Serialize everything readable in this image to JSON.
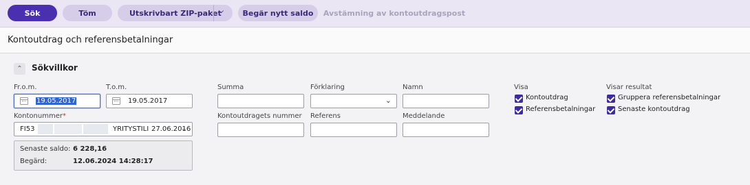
{
  "toolbar": {
    "search": "Sök",
    "clear": "Töm",
    "zip": "Utskrivbart ZIP-paket",
    "request_balance": "Begär nytt saldo",
    "reconcile": "Avstämning av kontoutdragspost"
  },
  "page_title": "Kontoutdrag och referensbetalningar",
  "section": {
    "title": "Sökvillkor"
  },
  "form": {
    "from_label": "Fr.o.m.",
    "from_value": "19.05.2017",
    "to_label": "T.o.m.",
    "to_value": "19.05.2017",
    "account_label": "Kontonummer",
    "required_mark": "*",
    "account_prefix": "FI53",
    "account_name": "YRITYSTILI",
    "account_date": "27.06.2016",
    "sum_label": "Summa",
    "explanation_label": "Förklaring",
    "name_label": "Namn",
    "statement_number_label": "Kontoutdragets nummer",
    "reference_label": "Referens",
    "message_label": "Meddelande"
  },
  "info": {
    "latest_balance_label": "Senaste saldo:",
    "latest_balance_value": "6 228,16",
    "requested_label": "Begärd:",
    "requested_value": "12.06.2024 14:28:17"
  },
  "show": {
    "title": "Visa",
    "options": [
      {
        "label": "Kontoutdrag",
        "checked": true
      },
      {
        "label": "Referensbetalningar",
        "checked": true
      }
    ]
  },
  "results": {
    "title": "Visar resultat",
    "options": [
      {
        "label": "Gruppera referensbetalningar",
        "checked": true
      },
      {
        "label": "Senaste kontoutdrag",
        "checked": true
      }
    ]
  }
}
